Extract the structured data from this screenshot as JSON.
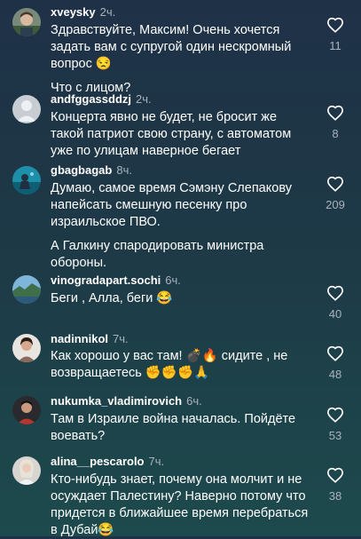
{
  "comments": [
    {
      "username": "xveysky",
      "time": "2ч.",
      "paragraphs": [
        "Здравствуйте, Максим! Очень хочется задать вам с супругой один нескромный вопрос 😒",
        "Что с лицом?"
      ],
      "likes": "11"
    },
    {
      "username": "andfggassddzj",
      "time": "2ч.",
      "paragraphs": [
        "Концерта явно не будет, не бросит же такой патриот свою страну, с автоматом уже по улицам наверное бегает"
      ],
      "likes": "8"
    },
    {
      "username": "gbagbagab",
      "time": "8ч.",
      "paragraphs": [
        "Думаю, самое время Сэмэну Слепакову напейсать смешную песенку про израильское ПВО.",
        "А Галкину спародировать министра обороны."
      ],
      "likes": "209"
    },
    {
      "username": "vinogradapart.sochi",
      "time": "6ч.",
      "paragraphs": [
        "Беги , Алла, беги 😂"
      ],
      "likes": "40"
    },
    {
      "username": "nadinnikol",
      "time": "7ч.",
      "paragraphs": [
        "Как хорошо у вас там! 💣🔥 сидите , не возвращаетесь ✊✊✊🙏"
      ],
      "likes": "48"
    },
    {
      "username": "nukumka_vladimirovich",
      "time": "6ч.",
      "paragraphs": [
        "Там в Израиле война началась. Пойдёте воевать?"
      ],
      "likes": "53"
    },
    {
      "username": "alina__pescarolo",
      "time": "7ч.",
      "paragraphs": [
        "Кто-нибудь знает, почему она молчит и не осуждает Палестину? Наверно потому что придется в ближайшее время перебраться в Дубай😂"
      ],
      "likes": "38"
    }
  ]
}
